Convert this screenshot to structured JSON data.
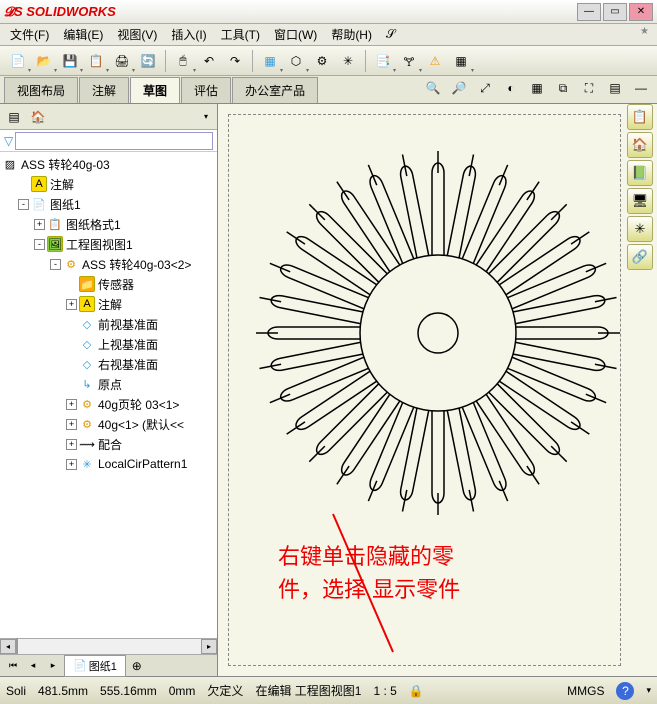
{
  "title": {
    "logo": "SOLIDWORKS"
  },
  "menus": [
    "文件(F)",
    "编辑(E)",
    "视图(V)",
    "插入(I)",
    "工具(T)",
    "窗口(W)",
    "帮助(H)",
    "𝒮"
  ],
  "tabs": {
    "items": [
      "视图布局",
      "注解",
      "草图",
      "评估",
      "办公室产品"
    ],
    "active_index": 2
  },
  "tree": {
    "root": "ASS 转轮40g-03",
    "nodes": [
      {
        "ind": 1,
        "exp": "",
        "icon": "A",
        "iconbg": "#fd0",
        "label": "注解"
      },
      {
        "ind": 1,
        "exp": "-",
        "icon": "📄",
        "label": "图纸1"
      },
      {
        "ind": 2,
        "exp": "+",
        "icon": "📋",
        "label": "图纸格式1"
      },
      {
        "ind": 2,
        "exp": "-",
        "icon": "🖼",
        "iconbg": "#8c4",
        "label": "工程图视图1"
      },
      {
        "ind": 3,
        "exp": "-",
        "icon": "⚙",
        "iconcolor": "#d90",
        "label": "ASS 转轮40g-03<2>"
      },
      {
        "ind": 4,
        "exp": "",
        "icon": "📁",
        "iconbg": "#fa0",
        "label": "传感器"
      },
      {
        "ind": 4,
        "exp": "+",
        "icon": "A",
        "iconbg": "#fd0",
        "label": "注解"
      },
      {
        "ind": 4,
        "exp": "",
        "icon": "◇",
        "iconcolor": "#3a9bd8",
        "label": "前视基准面"
      },
      {
        "ind": 4,
        "exp": "",
        "icon": "◇",
        "iconcolor": "#3a9bd8",
        "label": "上视基准面"
      },
      {
        "ind": 4,
        "exp": "",
        "icon": "◇",
        "iconcolor": "#3a9bd8",
        "label": "右视基准面"
      },
      {
        "ind": 4,
        "exp": "",
        "icon": "↳",
        "iconcolor": "#3a9bd8",
        "label": "原点"
      },
      {
        "ind": 4,
        "exp": "+",
        "icon": "⚙",
        "iconcolor": "#d90",
        "label": "40g页轮 03<1>"
      },
      {
        "ind": 4,
        "exp": "+",
        "icon": "⚙",
        "iconcolor": "#d90",
        "label": "40g<1> (默认<<"
      },
      {
        "ind": 4,
        "exp": "+",
        "icon": "⟿",
        "label": "配合"
      },
      {
        "ind": 4,
        "exp": "+",
        "icon": "✳",
        "iconcolor": "#3a9bd8",
        "label": "LocalCirPattern1"
      }
    ]
  },
  "bottomtabs": {
    "tab1": "图纸1"
  },
  "annotation": {
    "line1": "右键单击隐藏的零",
    "line2": "件，选择 显示零件"
  },
  "filter": {
    "placeholder": ""
  },
  "status": {
    "app": "Soli",
    "x": "481.5mm",
    "y": "555.16mm",
    "z": "0mm",
    "def": "欠定义",
    "edit": "在编辑 工程图视图1",
    "scale": "1 : 5",
    "units": "MMGS"
  },
  "colors": {
    "accent": "#d00",
    "link": "#3a6bd8"
  }
}
